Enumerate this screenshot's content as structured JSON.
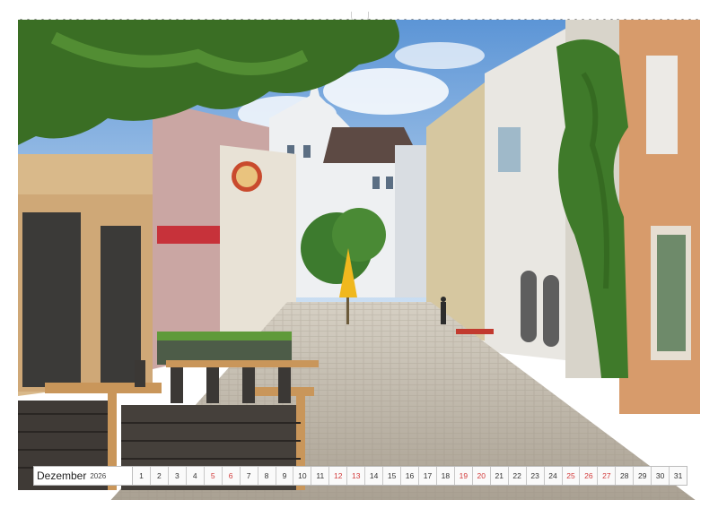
{
  "calendar": {
    "month": "Dezember",
    "year": "2026",
    "days": [
      "1",
      "2",
      "3",
      "4",
      "5",
      "6",
      "7",
      "8",
      "9",
      "10",
      "11",
      "12",
      "13",
      "14",
      "15",
      "16",
      "17",
      "18",
      "19",
      "20",
      "21",
      "22",
      "23",
      "24",
      "25",
      "26",
      "27",
      "28",
      "29",
      "30",
      "31"
    ],
    "weekend_days": [
      "5",
      "6",
      "12",
      "13",
      "19",
      "20",
      "25",
      "26",
      "27"
    ],
    "weekend_color": "#d23a3a"
  },
  "photo": {
    "subject": "cobblestone-old-town-street",
    "shop_sign_text": "",
    "colors": {
      "sky": "#7fb2e0",
      "cobblestone": "#c9c2b3",
      "foliage": "#3f7a2a",
      "umbrella": "#f0b81e"
    }
  }
}
